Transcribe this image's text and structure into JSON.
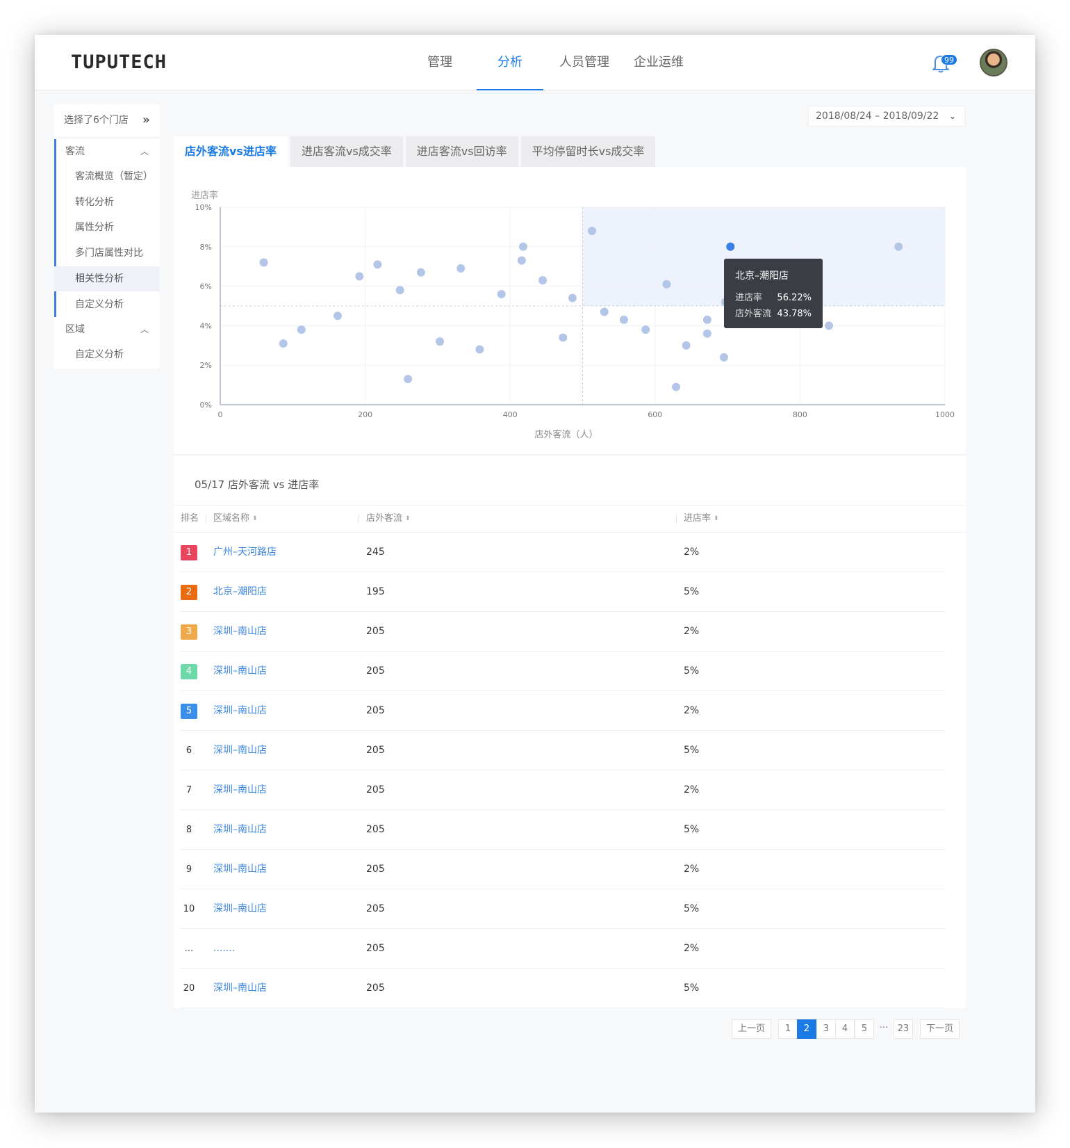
{
  "header": {
    "logo": "TUPUTECH",
    "nav": [
      "管理",
      "分析",
      "人员管理",
      "企业运维"
    ],
    "active_nav": 1,
    "notification_count": "99"
  },
  "sidebar": {
    "store_select_label": "选择了6个门店",
    "groups": [
      {
        "label": "客流",
        "items": [
          "客流概览（暂定）",
          "转化分析",
          "属性分析",
          "多门店属性对比",
          "相关性分析",
          "自定义分析"
        ]
      },
      {
        "label": "区域",
        "items": [
          "自定义分析"
        ]
      }
    ],
    "active_item": "相关性分析"
  },
  "date_range": "2018/08/24 – 2018/09/22",
  "tabs": [
    "店外客流vs进店率",
    "进店客流vs成交率",
    "进店客流vs回访率",
    "平均停留时长vs成交率"
  ],
  "active_tab": 0,
  "chart_data": {
    "type": "scatter",
    "title": "",
    "ylabel": "进店率",
    "xlabel": "店外客流（人）",
    "xlim": [
      0,
      1000
    ],
    "ylim": [
      0,
      10
    ],
    "x_ticks": [
      "0",
      "200",
      "400",
      "600",
      "800",
      "1000"
    ],
    "y_ticks": [
      "0%",
      "2%",
      "4%",
      "6%",
      "8%",
      "10%"
    ],
    "reference_lines": {
      "x": 500,
      "y": 5
    },
    "highlight_quadrant": {
      "x_min": 500,
      "y_min": 5
    },
    "points": [
      {
        "x": 60,
        "y": 7.2
      },
      {
        "x": 87,
        "y": 3.1
      },
      {
        "x": 112,
        "y": 3.8
      },
      {
        "x": 162,
        "y": 4.5
      },
      {
        "x": 192,
        "y": 6.5
      },
      {
        "x": 217,
        "y": 7.1
      },
      {
        "x": 248,
        "y": 5.8
      },
      {
        "x": 259,
        "y": 1.3
      },
      {
        "x": 277,
        "y": 6.7
      },
      {
        "x": 303,
        "y": 3.2
      },
      {
        "x": 332,
        "y": 6.9
      },
      {
        "x": 358,
        "y": 2.8
      },
      {
        "x": 388,
        "y": 5.6
      },
      {
        "x": 416,
        "y": 7.3
      },
      {
        "x": 418,
        "y": 8.0
      },
      {
        "x": 445,
        "y": 6.3
      },
      {
        "x": 473,
        "y": 3.4
      },
      {
        "x": 486,
        "y": 5.4
      },
      {
        "x": 513,
        "y": 8.8
      },
      {
        "x": 530,
        "y": 4.7
      },
      {
        "x": 557,
        "y": 4.3
      },
      {
        "x": 587,
        "y": 3.8
      },
      {
        "x": 616,
        "y": 6.1
      },
      {
        "x": 629,
        "y": 0.9
      },
      {
        "x": 643,
        "y": 3.0
      },
      {
        "x": 672,
        "y": 4.3
      },
      {
        "x": 672,
        "y": 3.6
      },
      {
        "x": 695,
        "y": 2.4
      },
      {
        "x": 697,
        "y": 5.2
      },
      {
        "x": 760,
        "y": 4.1
      },
      {
        "x": 840,
        "y": 4.0
      },
      {
        "x": 936,
        "y": 8.0
      },
      {
        "x": 704,
        "y": 8.0,
        "highlighted": true
      }
    ],
    "tooltip": {
      "title": "北京–潮阳店",
      "rows": [
        [
          "进店率",
          "56.22%"
        ],
        [
          "店外客流",
          "43.78%"
        ]
      ]
    },
    "colors": {
      "point": "#b3c6e7",
      "highlight": "#3a7fe3",
      "quadrant": "#edf2fc"
    }
  },
  "table": {
    "title": "05/17 店外客流 vs 进店率",
    "headers": [
      "排名",
      "区域名称",
      "店外客流",
      "进店率"
    ],
    "rows": [
      {
        "rank": "1",
        "name": "广州–天河路店",
        "traffic": "245",
        "rate": "2%",
        "badge": "#e9455e"
      },
      {
        "rank": "2",
        "name": "北京–潮阳店",
        "traffic": "195",
        "rate": "5%",
        "badge": "#ec6b10"
      },
      {
        "rank": "3",
        "name": "深圳–南山店",
        "traffic": "205",
        "rate": "2%",
        "badge": "#f0a94a"
      },
      {
        "rank": "4",
        "name": "深圳–南山店",
        "traffic": "205",
        "rate": "5%",
        "badge": "#6dd8a8"
      },
      {
        "rank": "5",
        "name": "深圳–南山店",
        "traffic": "205",
        "rate": "2%",
        "badge": "#3c8fe8"
      },
      {
        "rank": "6",
        "name": "深圳–南山店",
        "traffic": "205",
        "rate": "5%",
        "badge": ""
      },
      {
        "rank": "7",
        "name": "深圳–南山店",
        "traffic": "205",
        "rate": "2%",
        "badge": ""
      },
      {
        "rank": "8",
        "name": "深圳–南山店",
        "traffic": "205",
        "rate": "5%",
        "badge": ""
      },
      {
        "rank": "9",
        "name": "深圳–南山店",
        "traffic": "205",
        "rate": "2%",
        "badge": ""
      },
      {
        "rank": "10",
        "name": "深圳–南山店",
        "traffic": "205",
        "rate": "5%",
        "badge": ""
      },
      {
        "rank": "...",
        "name": ".......",
        "traffic": "205",
        "rate": "2%",
        "badge": ""
      },
      {
        "rank": "20",
        "name": "深圳–南山店",
        "traffic": "205",
        "rate": "5%",
        "badge": ""
      }
    ]
  },
  "pagination": {
    "prev": "上一页",
    "pages": [
      "1",
      "2",
      "3",
      "4",
      "5",
      "···",
      "23"
    ],
    "current": "2",
    "next": "下一页"
  }
}
